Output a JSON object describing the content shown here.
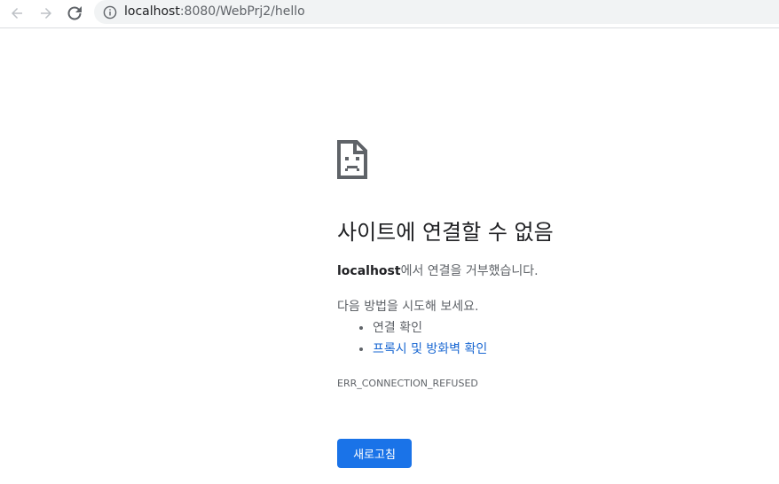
{
  "browser": {
    "url_host": "localhost",
    "url_rest": ":8080/WebPrj2/hello",
    "icons": {
      "back": "back-arrow-icon",
      "forward": "forward-arrow-icon",
      "reload": "reload-icon",
      "info": "info-icon"
    }
  },
  "error_page": {
    "icon": "sad-page-icon",
    "heading": "사이트에 연결할 수 없음",
    "host": "localhost",
    "message_suffix": "에서 연결을 거부했습니다.",
    "suggestions_title": "다음 방법을 시도해 보세요.",
    "suggestions": [
      {
        "label": "연결 확인",
        "link": false
      },
      {
        "label": "프록시 및 방화벽 확인",
        "link": true
      }
    ],
    "error_code": "ERR_CONNECTION_REFUSED",
    "reload_label": "새로고침"
  },
  "colors": {
    "accent": "#1a73e8",
    "link": "#1967d2",
    "text_secondary": "#5f6368",
    "text_primary": "#202124"
  }
}
